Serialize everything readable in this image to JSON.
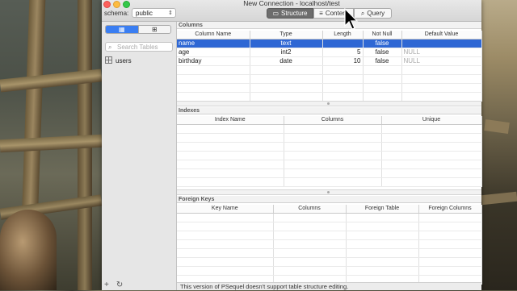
{
  "window": {
    "title": "New Connection - localhost/test"
  },
  "toolbar": {
    "schema_label": "schema:",
    "schema_value": "public",
    "segments": [
      {
        "label": "Structure",
        "icon": "structure-icon",
        "active": true
      },
      {
        "label": "Content",
        "icon": "list-icon",
        "active": false
      },
      {
        "label": "Query",
        "icon": "search-icon",
        "active": false
      }
    ]
  },
  "sidebar": {
    "search_placeholder": "Search Tables",
    "tables": [
      "users"
    ]
  },
  "columns_section": {
    "title": "Columns",
    "headers": [
      "Column Name",
      "Type",
      "Length",
      "Not Null",
      "Default Value"
    ],
    "rows": [
      [
        "name",
        "text",
        "",
        "false",
        ""
      ],
      [
        "age",
        "int2",
        "5",
        "false",
        "NULL"
      ],
      [
        "birthday",
        "date",
        "10",
        "false",
        "NULL"
      ]
    ]
  },
  "indexes_section": {
    "title": "Indexes",
    "headers": [
      "Index Name",
      "Columns",
      "Unique"
    ]
  },
  "foreign_keys_section": {
    "title": "Foreign Keys",
    "headers": [
      "Key Name",
      "Columns",
      "Foreign Table",
      "Foreign Columns"
    ]
  },
  "footer": {
    "message": "This version of PSequel doesn't support table structure editing."
  },
  "colors": {
    "selection": "#2e67d4",
    "active_segment": "#6d6d6d",
    "toggle_on": "#3a7ef2"
  }
}
